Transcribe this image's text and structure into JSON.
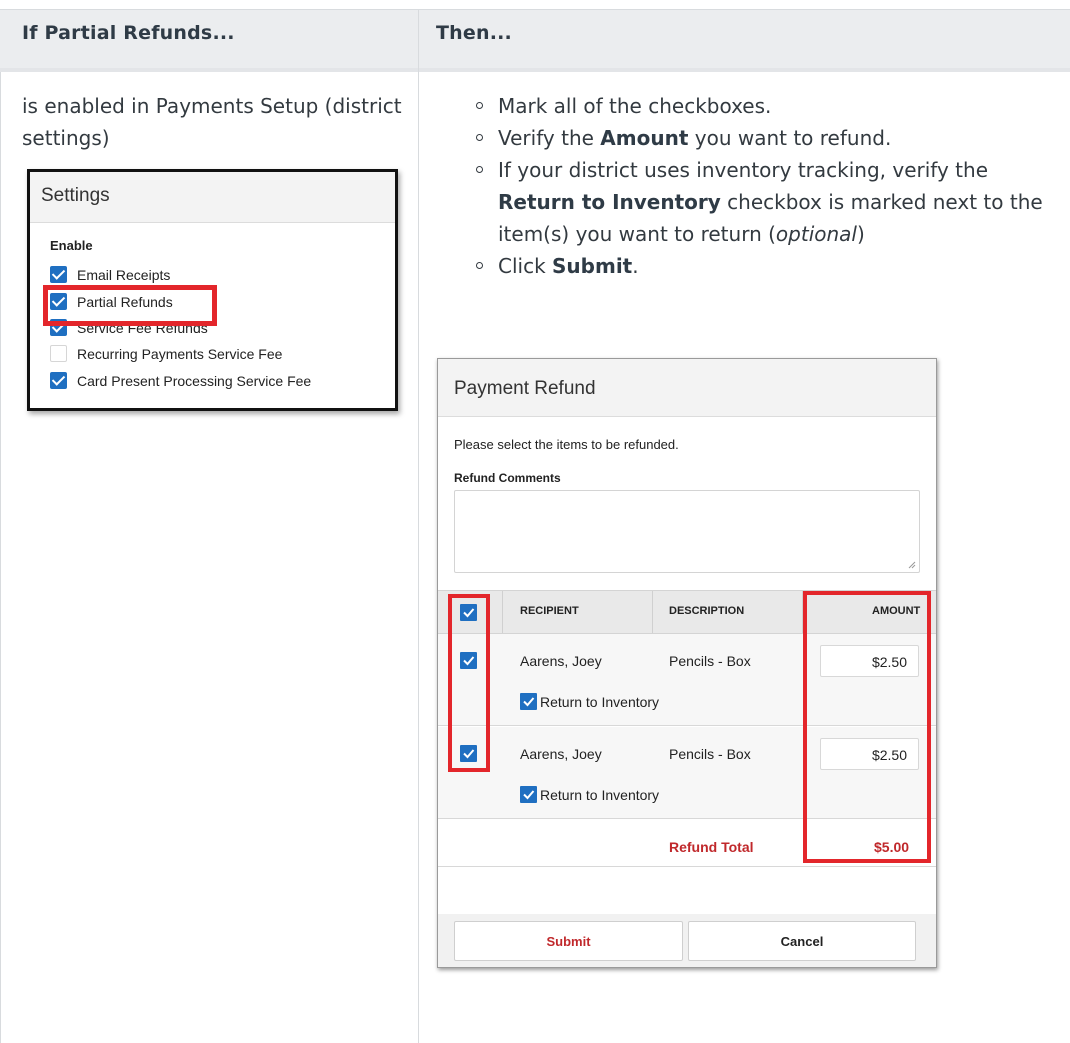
{
  "table": {
    "header_left": "If Partial Refunds...",
    "header_right": "Then...",
    "left_text": "is enabled in Payments Setup (district settings)"
  },
  "settings_panel": {
    "title": "Settings",
    "enable_label": "Enable",
    "items": [
      {
        "label": "Email Receipts",
        "checked": true
      },
      {
        "label": "Partial Refunds",
        "checked": true
      },
      {
        "label": "Service Fee Refunds",
        "checked": true
      },
      {
        "label": "Recurring Payments Service Fee",
        "checked": false
      },
      {
        "label": "Card Present Processing Service Fee",
        "checked": true
      }
    ]
  },
  "steps": {
    "s1": "Mark all of the checkboxes.",
    "s2_pre": "Verify the ",
    "s2_bold": "Amount",
    "s2_post": " you want to refund.",
    "s3_pre": "If your district uses inventory tracking, verify the ",
    "s3_bold": "Return to Inventory",
    "s3_mid": " checkbox is marked next to the item(s) you want to return (",
    "s3_italic": "optional",
    "s3_post": ")",
    "s4_pre": "Click ",
    "s4_bold": "Submit",
    "s4_post": "."
  },
  "refund_dialog": {
    "title": "Payment Refund",
    "prompt": "Please select the items to be refunded.",
    "comments_label": "Refund Comments",
    "columns": {
      "recipient": "RECIPIENT",
      "description": "DESCRIPTION",
      "amount": "AMOUNT"
    },
    "rows": [
      {
        "recipient": "Aarens, Joey",
        "description": "Pencils - Box",
        "amount": "$2.50",
        "return_label": "Return to Inventory"
      },
      {
        "recipient": "Aarens, Joey",
        "description": "Pencils - Box",
        "amount": "$2.50",
        "return_label": "Return to Inventory"
      }
    ],
    "total_label": "Refund Total",
    "total_value": "$5.00",
    "submit_label": "Submit",
    "cancel_label": "Cancel"
  },
  "colors": {
    "highlight_red": "#e3262b",
    "checkbox_blue": "#1f6fc1",
    "total_red": "#c0282b"
  }
}
